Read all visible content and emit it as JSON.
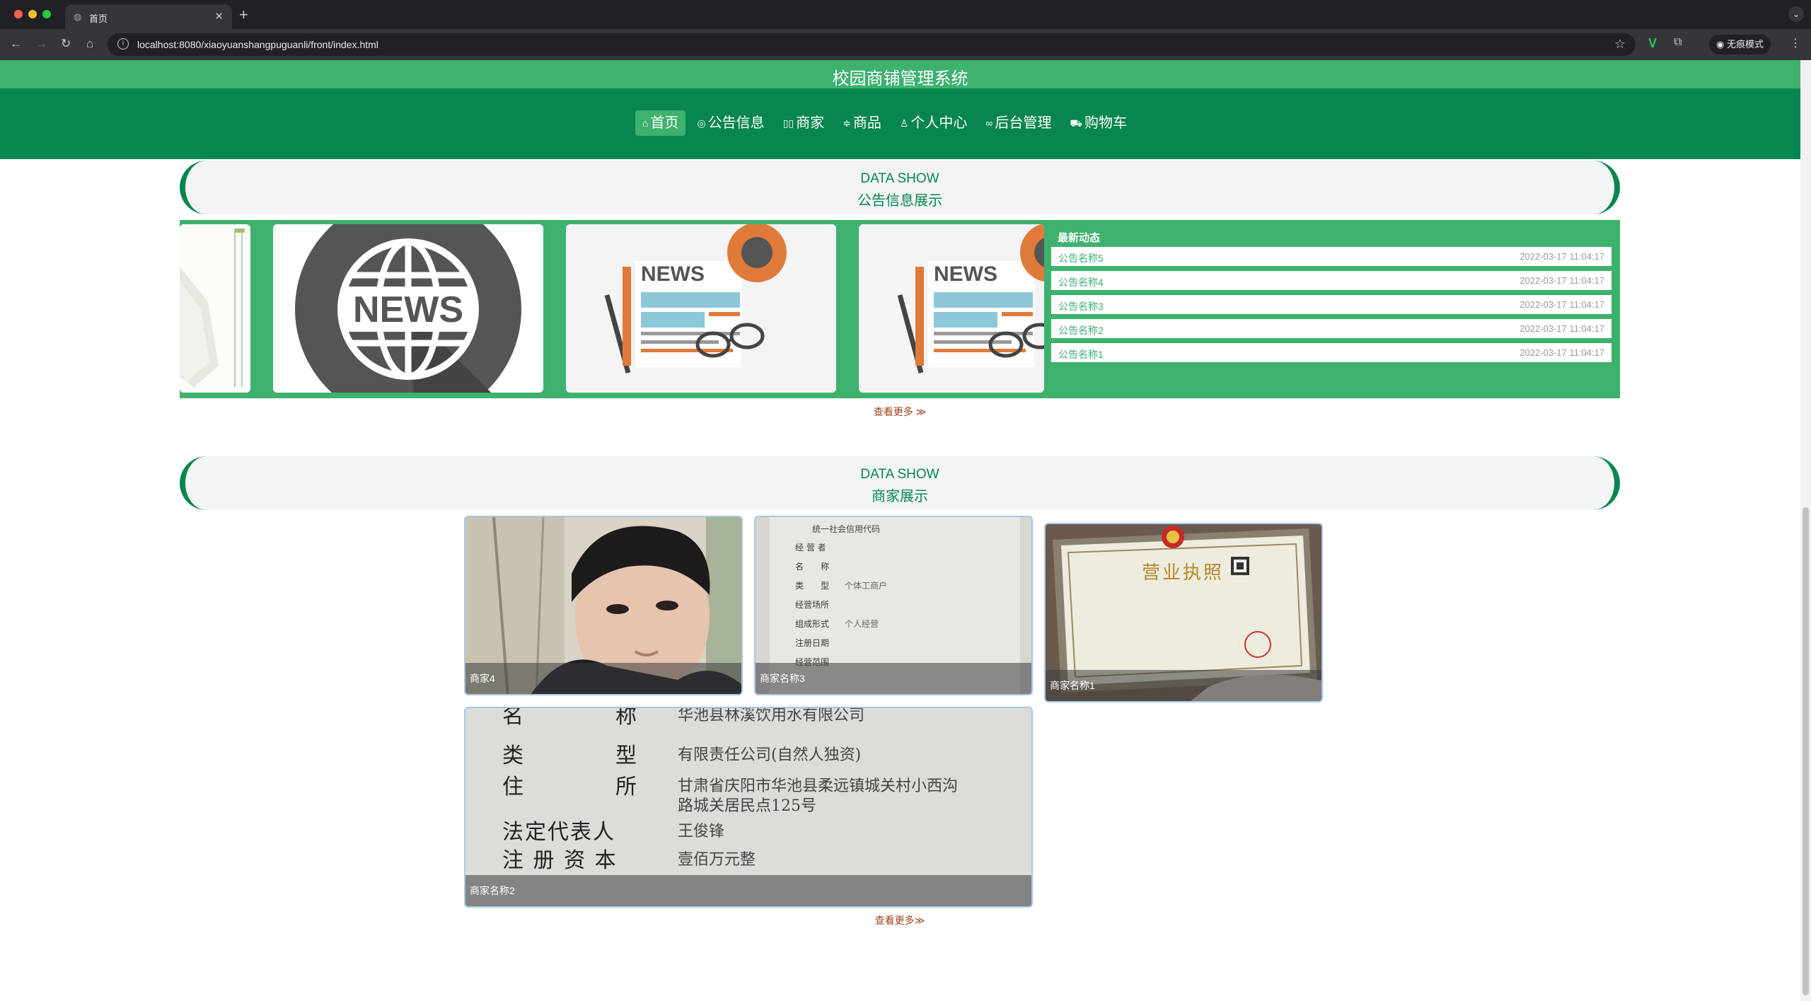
{
  "browser": {
    "tab_title": "首页",
    "url": "localhost:8080/xiaoyuanshangpuguanli/front/index.html",
    "incognito_label": "无痕模式"
  },
  "site": {
    "title": "校园商铺管理系统",
    "nav": [
      {
        "label": "首页",
        "icon": "home-icon",
        "glyph": "⌂",
        "active": true
      },
      {
        "label": "公告信息",
        "icon": "target-icon",
        "glyph": "◎",
        "active": false
      },
      {
        "label": "商家",
        "icon": "store-icon",
        "glyph": "▯▯",
        "active": false
      },
      {
        "label": "商品",
        "icon": "sliders-icon",
        "glyph": "≑",
        "active": false
      },
      {
        "label": "个人中心",
        "icon": "user-icon",
        "glyph": "♙",
        "active": false
      },
      {
        "label": "后台管理",
        "icon": "link-icon",
        "glyph": "∞",
        "active": false
      },
      {
        "label": "购物车",
        "icon": "cart-icon",
        "glyph": "⛟",
        "active": false
      }
    ]
  },
  "notice_section": {
    "en_title": "DATA SHOW",
    "zh_title": "公告信息展示",
    "news_panel_title": "最新动态",
    "news": [
      {
        "name": "公告名称5",
        "date": "2022-03-17 11:04:17"
      },
      {
        "name": "公告名称4",
        "date": "2022-03-17 11:04:17"
      },
      {
        "name": "公告名称3",
        "date": "2022-03-17 11:04:17"
      },
      {
        "name": "公告名称2",
        "date": "2022-03-17 11:04:17"
      },
      {
        "name": "公告名称1",
        "date": "2022-03-17 11:04:17"
      }
    ],
    "more_label": "查看更多 ≫",
    "carousel_text": [
      "NEWS",
      "NEWS",
      "NEWS"
    ]
  },
  "shop_section": {
    "en_title": "DATA SHOW",
    "zh_title": "商家展示",
    "shops": [
      "商家4",
      "商家名称3",
      "商家名称1",
      "商家名称2"
    ],
    "more_label": "查看更多≫",
    "license_texts": {
      "cert_title": "统一社会信用代码",
      "cert_fields": [
        "经 营 者",
        "名　　称",
        "类　　型",
        "经营场所",
        "组成形式",
        "注册日期",
        "经营范围"
      ],
      "cert_values": [
        "",
        "",
        "个体工商户",
        "",
        "个人经营",
        "",
        ""
      ],
      "license_title": "营业执照",
      "fields_big": [
        {
          "k": "名　　　　称",
          "v": "华池县林溪饮用水有限公司"
        },
        {
          "k": "类　　　　型",
          "v": "有限责任公司(自然人独资)"
        },
        {
          "k": "住　　　　所",
          "v": "甘肃省庆阳市华池县柔远镇城关村小西沟"
        },
        {
          "k": "",
          "v": "路城关居民点125号"
        },
        {
          "k": "法定代表人",
          "v": "王俊锋"
        },
        {
          "k": "注 册 资 本",
          "v": "壹佰万元整"
        }
      ]
    }
  },
  "colors": {
    "primary_green": "#07864f",
    "accent_green": "#3eb16f",
    "more_link": "#a0421a"
  }
}
